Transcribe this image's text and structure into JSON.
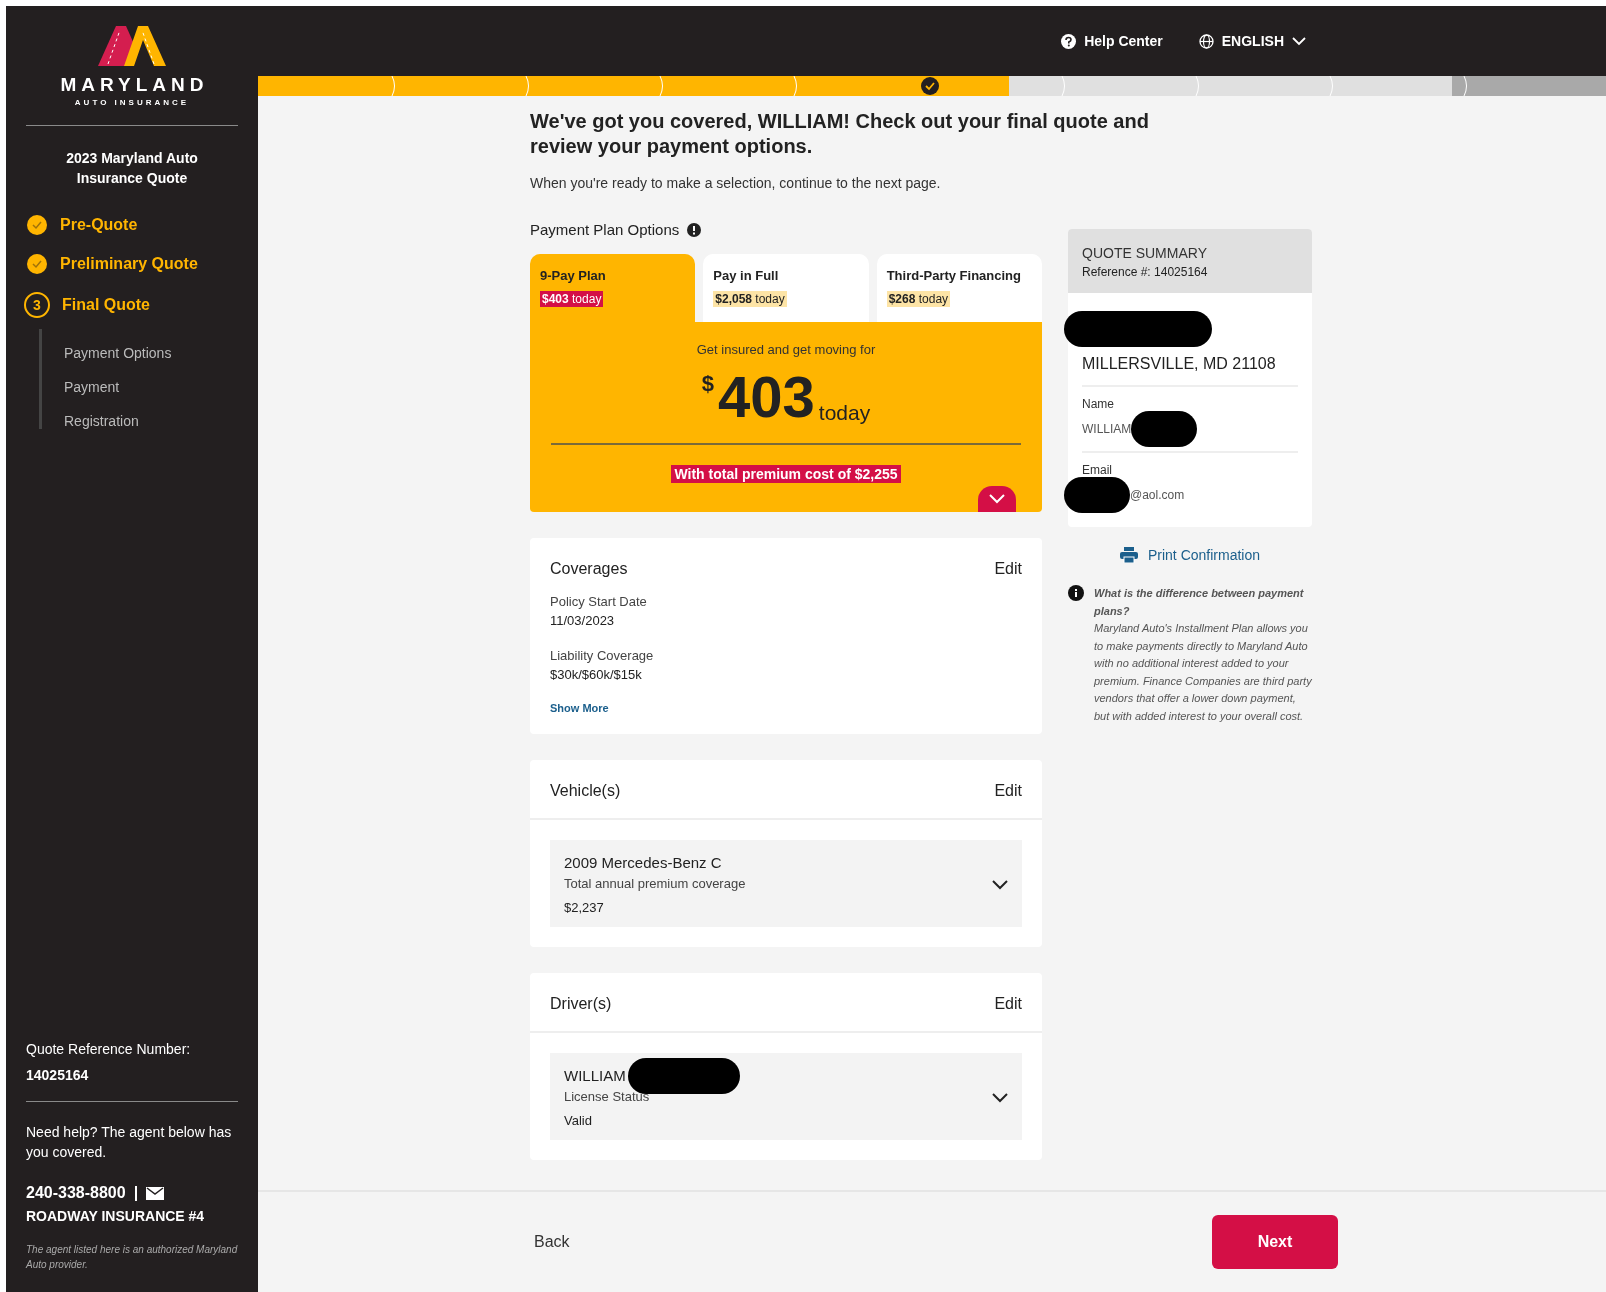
{
  "sidebar": {
    "brand": {
      "name": "MARYLAND",
      "tagline": "AUTO INSURANCE"
    },
    "quote_title": "2023 Maryland Auto Insurance Quote",
    "steps": [
      {
        "kind": "done",
        "label": "Pre-Quote"
      },
      {
        "kind": "done",
        "label": "Preliminary Quote"
      },
      {
        "kind": "current",
        "number": "3",
        "label": "Final Quote",
        "children": [
          {
            "label": "Payment Options"
          },
          {
            "label": "Payment"
          },
          {
            "label": "Registration"
          }
        ]
      }
    ],
    "reference_label": "Quote Reference Number:",
    "reference_number": "14025164",
    "help_text": "Need help? The agent below has you covered.",
    "phone": "240-338-8800",
    "separator": "|",
    "agent": "ROADWAY INSURANCE #4",
    "disclaimer": "The agent listed here is an authorized Maryland Auto provider."
  },
  "header": {
    "help": "Help Center",
    "language": "ENGLISH"
  },
  "progress": {
    "level": 0.557
  },
  "page": {
    "title": "We've got you covered, WILLIAM! Check out your final quote and review your payment options.",
    "subtitle": "When you're ready to make a selection, continue to the next page."
  },
  "plans": {
    "heading": "Payment Plan Options",
    "tabs": [
      {
        "label": "9-Pay Plan",
        "amount": "$403",
        "suffix": "today",
        "selected": true
      },
      {
        "label": "Pay in Full",
        "amount": "$2,058",
        "suffix": "today",
        "selected": false
      },
      {
        "label": "Third-Party Financing",
        "amount": "$268",
        "suffix": "today",
        "selected": false
      }
    ],
    "panel": {
      "intro": "Get insured and get moving for",
      "currency": "$",
      "price": "403",
      "suffix": "today",
      "total": "With total premium cost of $2,255"
    }
  },
  "coverages": {
    "title": "Coverages",
    "edit": "Edit",
    "items": [
      {
        "label": "Policy Start Date",
        "value": "11/03/2023"
      },
      {
        "label": "Liability Coverage",
        "value": "$30k/$60k/$15k"
      }
    ],
    "more": "Show More"
  },
  "vehicles": {
    "title": "Vehicle(s)",
    "edit": "Edit",
    "items": [
      {
        "name": "2009 Mercedes-Benz C",
        "label": "Total annual premium coverage",
        "value": "$2,237",
        "redacted": false
      }
    ]
  },
  "drivers": {
    "title": "Driver(s)",
    "edit": "Edit",
    "items": [
      {
        "name": "WILLIAM",
        "label": "License Status",
        "value": "Valid",
        "redacted": true
      }
    ]
  },
  "summary": {
    "title": "QUOTE SUMMARY",
    "reference": "Reference #: 14025164",
    "fields": [
      {
        "value": "MILLERSVILLE, MD 21108",
        "redacted": true
      },
      {
        "label": "Name",
        "value": "WILLIAM",
        "redacted": true
      },
      {
        "label": "Email",
        "value": "@aol.com",
        "redacted": true
      }
    ],
    "print": "Print Confirmation",
    "note_title": "What is the difference between payment plans?",
    "note_body": "Maryland Auto's Installment Plan allows you to make payments directly to Maryland Auto with no additional interest added to your premium. Finance Companies are third party vendors that offer a lower down payment, but with added interest to your overall cost."
  },
  "footer": {
    "back": "Back",
    "next": "Next"
  }
}
